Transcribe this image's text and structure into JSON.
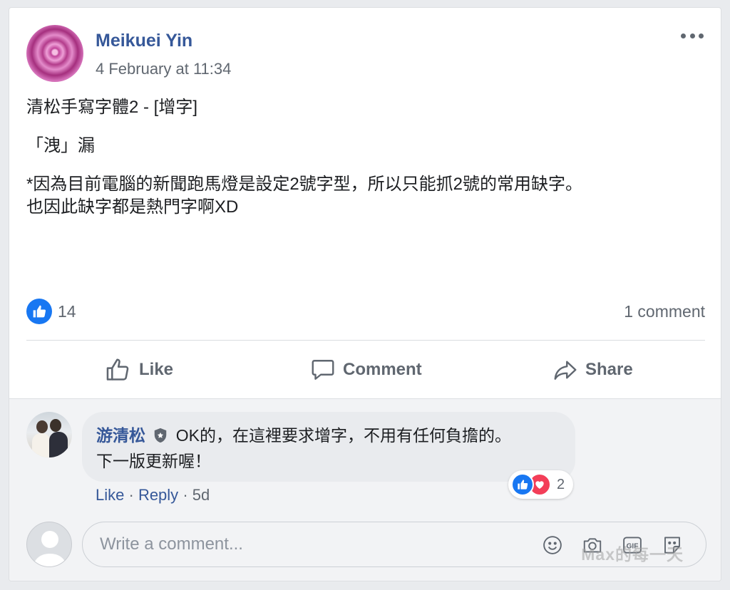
{
  "post": {
    "author": "Meikuei Yin",
    "timestamp": "4 February at 11:34",
    "lines": [
      "清松手寫字體2 - [增字]",
      "",
      "「洩」漏",
      "",
      "*因為目前電腦的新聞跑馬燈是設定2號字型，所以只能抓2號的常用缺字。",
      "也因此缺字都是熱門字啊XD"
    ],
    "reaction_count": "14",
    "comment_count": "1 comment"
  },
  "actions": {
    "like": "Like",
    "comment": "Comment",
    "share": "Share"
  },
  "comment": {
    "author": "游清松",
    "line1": "OK的，在這裡要求增字，不用有任何負擔的。",
    "line2": "下一版更新喔！",
    "reaction_count": "2",
    "like_link": "Like",
    "reply_link": "Reply",
    "age": "5d"
  },
  "composer": {
    "placeholder": "Write a comment..."
  },
  "watermark": "Max的每一天",
  "icons": {
    "more": "more-options-icon",
    "like": "thumbs-up-icon",
    "comment": "speech-bubble-icon",
    "share": "share-arrow-icon",
    "emoji": "emoji-icon",
    "camera": "camera-icon",
    "gif": "gif-icon",
    "sticker": "sticker-icon"
  },
  "colors": {
    "link": "#365899",
    "like_blue": "#1877f2",
    "love_red": "#f33e58",
    "secondary_text": "#606770"
  }
}
